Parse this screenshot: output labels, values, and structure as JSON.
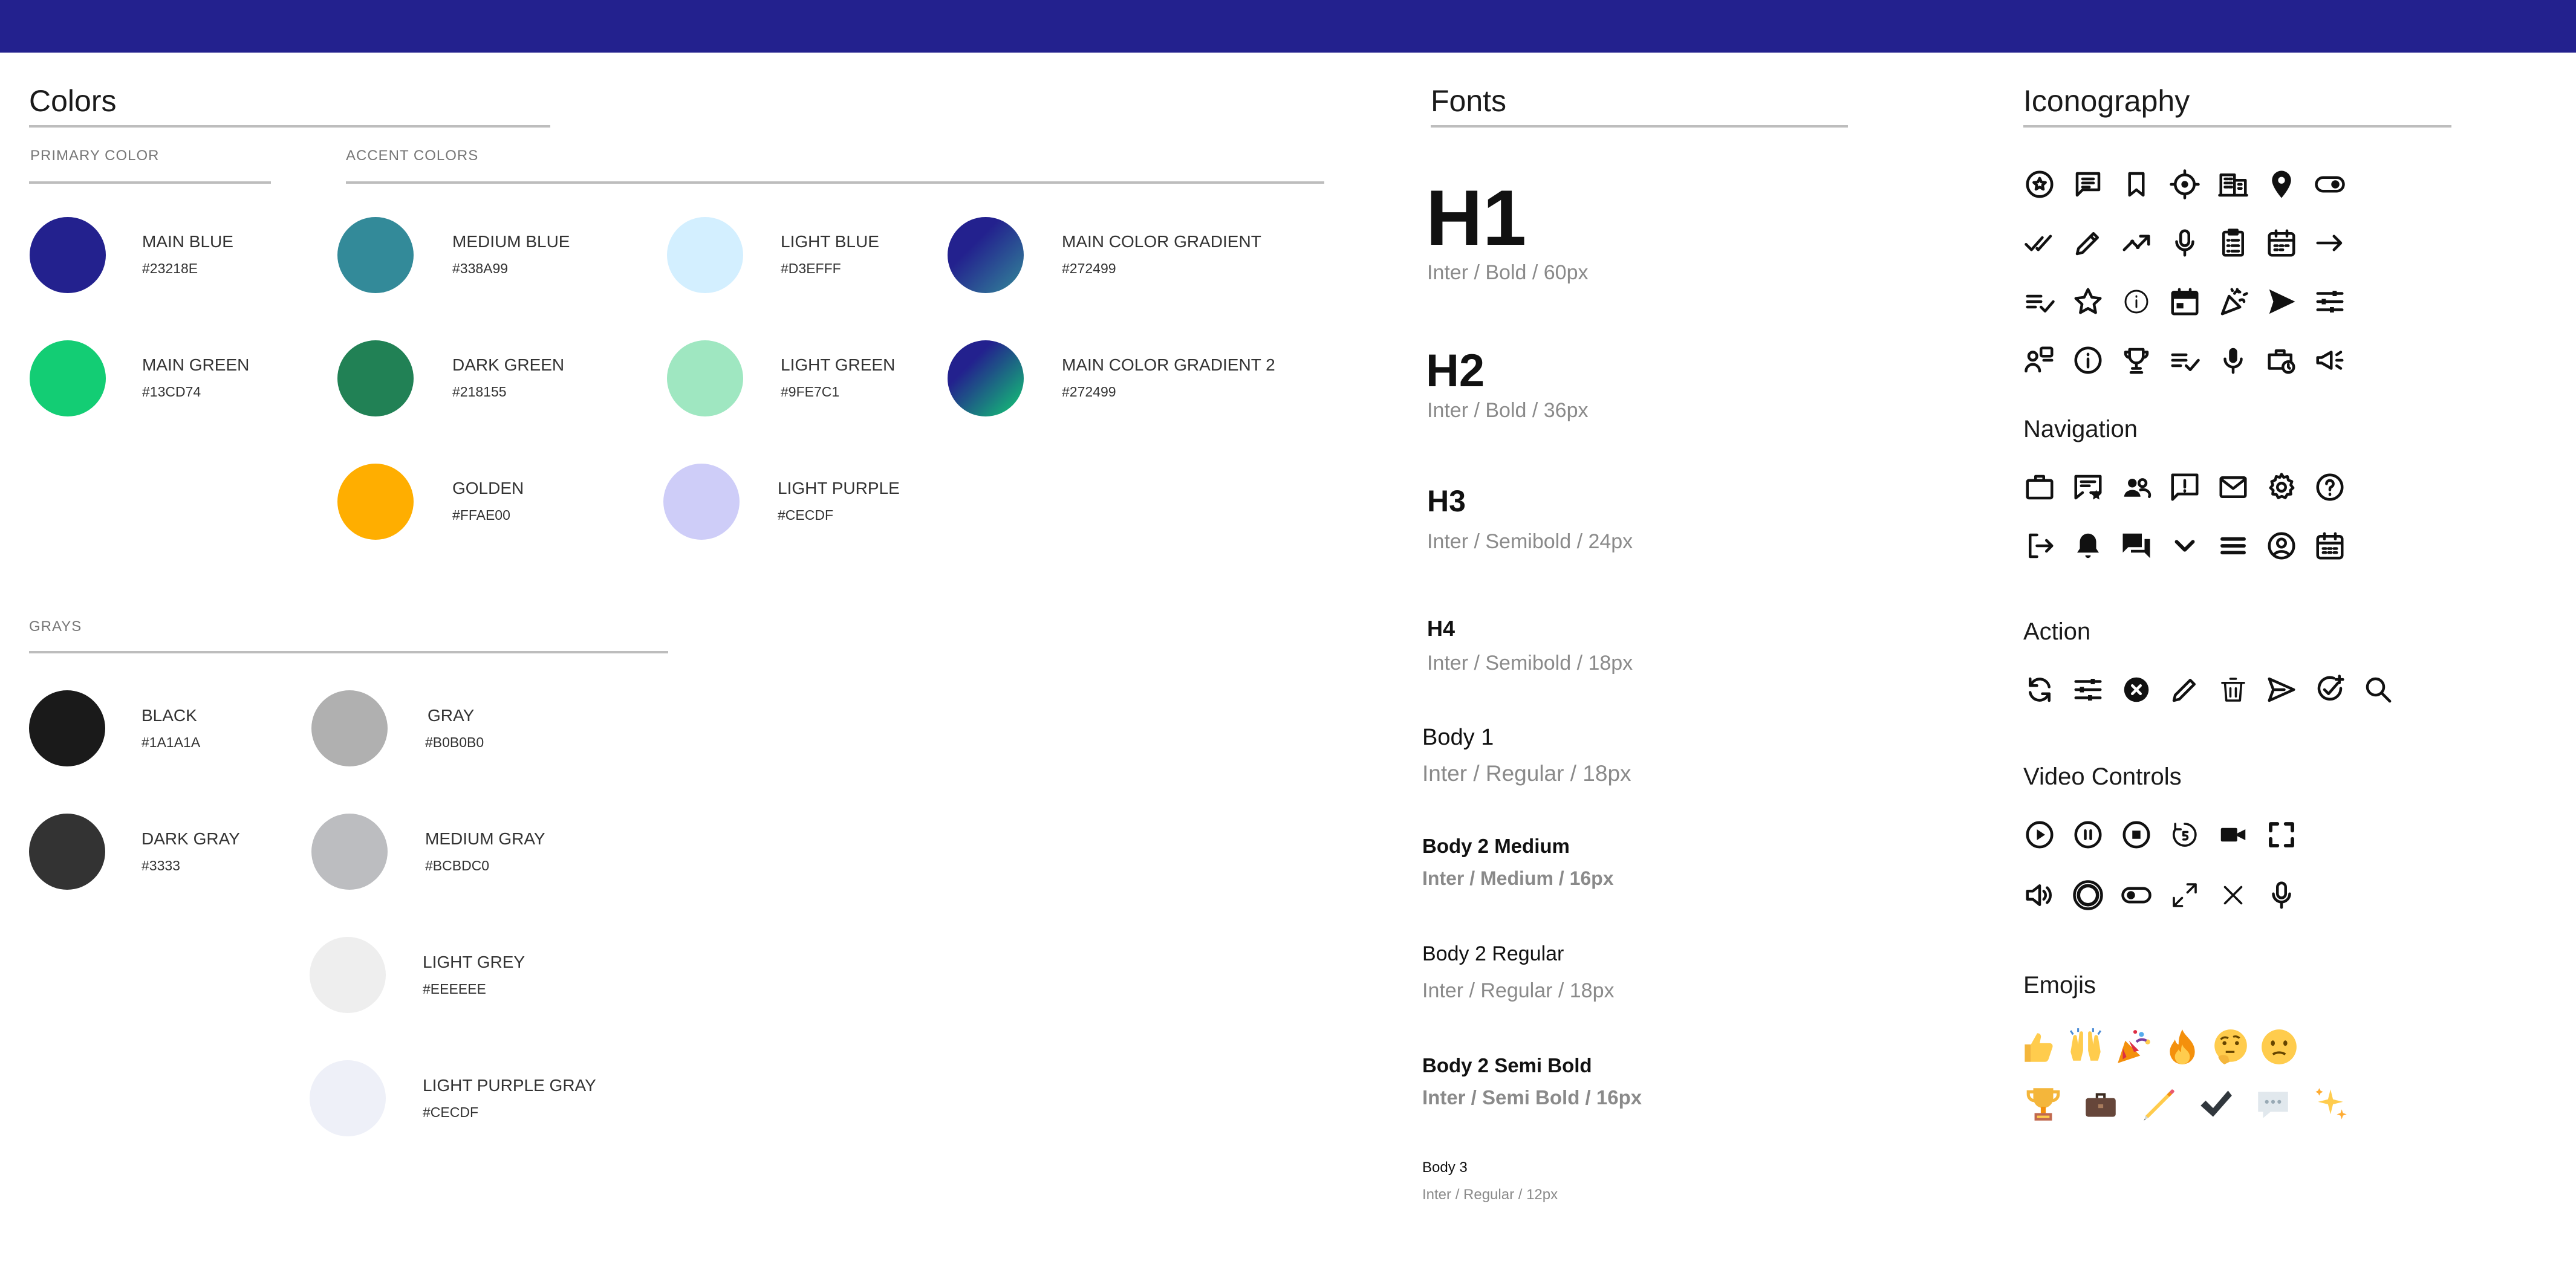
{
  "colors": {
    "heading": "Colors",
    "primary_label": "PRIMARY COLOR",
    "accent_label": "ACCENT COLORS",
    "grays_label": "GRAYS",
    "primary": [
      {
        "name": "MAIN BLUE",
        "hex": "#23218E",
        "color": "#23218e"
      },
      {
        "name": "MAIN GREEN",
        "hex": "#13CD74",
        "color": "#13cd74"
      }
    ],
    "accent": [
      {
        "name": "MEDIUM BLUE",
        "hex": "#338A99",
        "color": "#338a99"
      },
      {
        "name": "DARK GREEN",
        "hex": "#218155",
        "color": "#218155"
      },
      {
        "name": "GOLDEN",
        "hex": "#FFAE00",
        "color": "#ffae00"
      },
      {
        "name": "LIGHT BLUE",
        "hex": "#D3EFFF",
        "color": "#d3efff"
      },
      {
        "name": "LIGHT GREEN",
        "hex": "#9FE7C1",
        "color": "#9fe7c1"
      },
      {
        "name": "LIGHT PURPLE",
        "hex": "#CECDF",
        "color": "#cecdf8"
      },
      {
        "name": "MAIN COLOR GRADIENT",
        "hex": "#272499",
        "color": "#272499"
      },
      {
        "name": "MAIN COLOR GRADIENT 2",
        "hex": "#272499",
        "color": "#272499"
      }
    ],
    "grays": [
      {
        "name": "BLACK",
        "hex": "#1A1A1A",
        "color": "#1a1a1a"
      },
      {
        "name": "DARK GRAY",
        "hex": "#3333",
        "color": "#333333"
      },
      {
        "name": "GRAY",
        "hex": "#B0B0B0",
        "color": "#b0b0b0"
      },
      {
        "name": "MEDIUM GRAY",
        "hex": "#BCBDC0",
        "color": "#bcbdc0"
      },
      {
        "name": "LIGHT GREY",
        "hex": "#EEEEEE",
        "color": "#eeeeee"
      },
      {
        "name": "LIGHT PURPLE GRAY",
        "hex": "#CECDF",
        "color": "#eef0f8"
      }
    ]
  },
  "fonts": {
    "heading": "Fonts",
    "items": [
      {
        "title": "H1",
        "meta": "Inter / Bold / 60px"
      },
      {
        "title": "H2",
        "meta": "Inter / Bold / 36px"
      },
      {
        "title": "H3",
        "meta": "Inter / Semibold / 24px"
      },
      {
        "title": "H4",
        "meta": "Inter / Semibold / 18px"
      },
      {
        "title": "Body 1",
        "meta": "Inter / Regular / 18px"
      },
      {
        "title": "Body 2 Medium",
        "meta": "Inter /  Medium / 16px"
      },
      {
        "title": "Body 2 Regular",
        "meta": "Inter / Regular / 18px"
      },
      {
        "title": "Body 2 Semi Bold",
        "meta": "Inter /  Semi Bold / 16px"
      },
      {
        "title": "Body 3",
        "meta": "Inter /  Regular / 12px"
      }
    ]
  },
  "iconography": {
    "heading": "Iconography",
    "navigation_heading": "Navigation",
    "action_heading": "Action",
    "video_heading": "Video Controls",
    "emojis_heading": "Emojis",
    "icons": [
      "badge-icon",
      "chat-icon",
      "bookmark-icon",
      "target-icon",
      "building-icon",
      "location-pin-icon",
      "toggle-icon",
      "double-check-icon",
      "pencil-icon",
      "trending-icon",
      "microphone-icon",
      "clipboard-list-icon",
      "calendar-icon",
      "arrow-right-icon",
      "checklist-icon",
      "star-icon",
      "info-small-icon",
      "calendar-filled-icon",
      "party-popper-icon",
      "send-icon",
      "sliders-icon",
      "people-chat-icon",
      "info-icon",
      "trophy-icon",
      "playlist-check-icon",
      "microphone-filled-icon",
      "briefcase-clock-icon",
      "megaphone-icon"
    ],
    "navigation_icons": [
      "briefcase-icon",
      "message-star-icon",
      "users-icon",
      "feedback-icon",
      "mail-icon",
      "gear-icon",
      "help-icon",
      "logout-icon",
      "bell-icon",
      "forum-icon",
      "chevron-down-icon",
      "menu-icon",
      "account-circle-icon",
      "calendar-grid-icon"
    ],
    "action_icons": [
      "refresh-icon",
      "tune-icon",
      "close-circle-icon",
      "edit-icon",
      "trash-icon",
      "send-outline-icon",
      "add-check-icon",
      "search-icon"
    ],
    "video_icons": [
      "play-icon",
      "pause-icon",
      "stop-icon",
      "replay-5-icon",
      "video-camera-icon",
      "fullscreen-icon",
      "volume-icon",
      "record-icon",
      "toggle-switch-icon",
      "expand-icon",
      "close-icon",
      "mic-icon"
    ],
    "emojis": [
      "thumbs-up-emoji",
      "raised-hands-emoji",
      "party-popper-emoji",
      "fire-emoji",
      "thinking-emoji",
      "confused-emoji",
      "trophy-emoji",
      "briefcase-emoji",
      "pencil-emoji",
      "check-mark-emoji",
      "speech-bubble-emoji",
      "sparkles-emoji"
    ]
  }
}
